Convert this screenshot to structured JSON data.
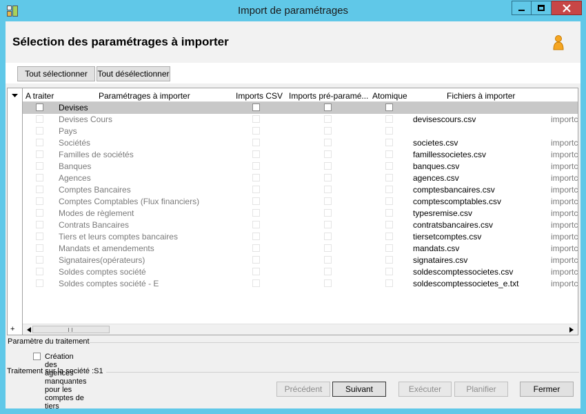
{
  "window": {
    "title": "Import de paramétrages",
    "icon": "app-grid-icon"
  },
  "header": {
    "title": "Sélection des paramétrages à importer",
    "icon": "user-icon"
  },
  "toolbar": {
    "select_all": "Tout sélectionner",
    "deselect_all": "Tout désélectionner"
  },
  "grid": {
    "columns": [
      "A traiter",
      "Paramétrages à importer",
      "Imports CSV",
      "Imports pré-paramé...",
      "Atomique",
      "Fichiers à importer"
    ],
    "rows": [
      {
        "label": "Devises",
        "file": "",
        "extra": ""
      },
      {
        "label": "Devises Cours",
        "file": "devisescours.csv",
        "extra": "importc"
      },
      {
        "label": "Pays",
        "file": "",
        "extra": ""
      },
      {
        "label": "Sociétés",
        "file": "societes.csv",
        "extra": "importc"
      },
      {
        "label": "Familles de sociétés",
        "file": "famillessocietes.csv",
        "extra": "importc"
      },
      {
        "label": "Banques",
        "file": "banques.csv",
        "extra": "importc"
      },
      {
        "label": "Agences",
        "file": "agences.csv",
        "extra": "importc"
      },
      {
        "label": "Comptes Bancaires",
        "file": "comptesbancaires.csv",
        "extra": "importc"
      },
      {
        "label": "Comptes Comptables (Flux financiers)",
        "file": "comptescomptables.csv",
        "extra": "importc"
      },
      {
        "label": "Modes de règlement",
        "file": "typesremise.csv",
        "extra": "importc"
      },
      {
        "label": "Contrats Bancaires",
        "file": "contratsbancaires.csv",
        "extra": "importc"
      },
      {
        "label": "Tiers et leurs comptes bancaires",
        "file": "tiersetcomptes.csv",
        "extra": "importc"
      },
      {
        "label": "Mandats et amendements",
        "file": "mandats.csv",
        "extra": "importc"
      },
      {
        "label": "Signataires(opérateurs)",
        "file": "signataires.csv",
        "extra": "importc"
      },
      {
        "label": "Soldes comptes société",
        "file": "soldescomptessocietes.csv",
        "extra": "importc"
      },
      {
        "label": "Soldes comptes société - E",
        "file": "soldescomptessocietes_e.txt",
        "extra": "importc"
      }
    ],
    "expand_symbol": "+"
  },
  "params": {
    "section_label": "Paramètre du traitement",
    "option_label": "Création des agences manquantes pour les comptes de tiers"
  },
  "footer": {
    "status_label": "Traitement sur la société :S1",
    "buttons": {
      "previous": "Précédent",
      "next": "Suivant",
      "execute": "Exécuter",
      "schedule": "Planifier",
      "close": "Fermer"
    }
  },
  "colors": {
    "titlebar": "#60c8e8",
    "selected_row": "#c8c8c8",
    "close_button": "#c74646"
  }
}
